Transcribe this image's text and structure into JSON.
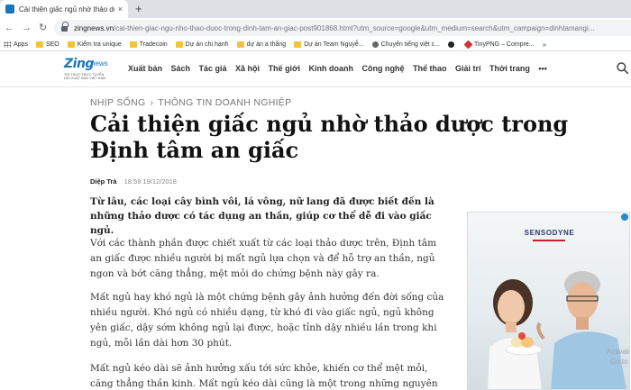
{
  "browser": {
    "tab": {
      "title": "Cải thiện giấc ngủ nhờ thảo dược",
      "close": "×"
    },
    "new_tab": "+",
    "nav": {
      "back": "←",
      "forward": "→",
      "reload": "↻"
    },
    "url": {
      "host": "zingnews.vn",
      "path": "/cai-thien-giac-ngu-nho-thao-duoc-trong-dinh-tam-an-giac-post901868.html?utm_source=google&utm_medium=search&utm_campaign=dinhtamangi..."
    },
    "bookmarks": [
      {
        "icon": "apps",
        "label": "Apps"
      },
      {
        "icon": "folder",
        "label": "SEO"
      },
      {
        "icon": "folder",
        "label": "Kiểm tra unique"
      },
      {
        "icon": "folder",
        "label": "Tradecoin"
      },
      {
        "icon": "folder",
        "label": "Dự án chị hạnh"
      },
      {
        "icon": "folder",
        "label": "dự án a thắng"
      },
      {
        "icon": "folder",
        "label": "Dự án Team Nguyễ..."
      },
      {
        "icon": "globe",
        "label": "Chuyển tiếng việt c..."
      },
      {
        "icon": "dot",
        "label": ""
      },
      {
        "icon": "gem",
        "label": "TinyPNG – Compre..."
      }
    ],
    "bookmarks_more": "»"
  },
  "site": {
    "logo": {
      "brand": "Zing",
      "suffix": "news",
      "tagline": "TRI THỨC TRỰC TUYẾN",
      "tagline2": "HỘI XUẤT BẢN VIỆT NAM"
    },
    "nav": [
      "Xuất bản",
      "Sách",
      "Tác giả",
      "Xã hội",
      "Thế giới",
      "Kinh doanh",
      "Công nghệ",
      "Thể thao",
      "Giải trí",
      "Thời trang",
      "•••"
    ]
  },
  "article": {
    "breadcrumb": [
      "NHỊP SỐNG",
      "THÔNG TIN DOANH NGHIỆP"
    ],
    "breadcrumb_sep": "›",
    "title": "Cải thiện giấc ngủ nhờ thảo dược trong Định tâm an giấc",
    "author": "Diệp Trà",
    "time": "18:59 19/12/2018",
    "sapo": "Từ lâu, các loại cây bình vôi, lá vông, nữ lang đã được biết đến là những thảo dược có tác dụng an thần, giúp cơ thể dễ đi vào giấc ngủ.",
    "paragraphs": [
      "Với các thành phần được chiết xuất từ các loại thảo dược trên, Định tâm an giấc được nhiều người bị mất ngủ lựa chọn và để hỗ trợ an thần, ngủ ngon và bớt căng thẳng, mệt mỏi do chứng bệnh này gây ra.",
      "Mất ngủ hay khó ngủ là một chứng bệnh gây ảnh hưởng đến đời sống của nhiều người. Khó ngủ có nhiều dạng, từ khó đi vào giấc ngủ, ngủ không yên giấc, dậy sớm không ngủ lại được, hoặc tỉnh dậy nhiều lần trong khi ngủ, mỗi lần dài hơn 30 phút.",
      "Mất ngủ kéo dài sẽ ảnh hưởng xấu tới sức khỏe, khiến cơ thể mệt mỏi, căng thẳng thần kinh. Mất ngủ kéo dài cũng là một trong những nguyên nhân dẫn"
    ]
  },
  "ad": {
    "brand": "SENSODYNE",
    "watermark_line1": "Activate W",
    "watermark_line2": "Go to Setti"
  }
}
